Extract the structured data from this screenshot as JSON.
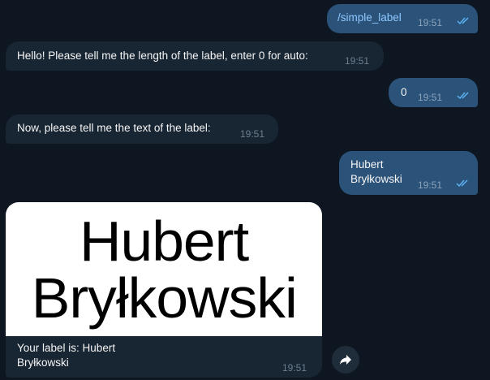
{
  "messages": [
    {
      "text": "/simple_label",
      "time": "19:51"
    },
    {
      "text": "Hello! Please tell me the length of the label, enter 0 for auto:",
      "time": "19:51"
    },
    {
      "text": "0",
      "time": "19:51"
    },
    {
      "text": "Now, please tell me the text of the label:",
      "time": "19:51"
    },
    {
      "line1": "Hubert",
      "line2": "Bryłkowski",
      "time": "19:51"
    }
  ],
  "label_card": {
    "image_line1": "Hubert",
    "image_line2": "Bryłkowski",
    "caption_line1": "Your label is: Hubert",
    "caption_line2": "Bryłkowski",
    "time": "19:51"
  },
  "icons": {
    "read_receipt": "double-check-icon",
    "forward": "forward-arrow-icon"
  },
  "colors": {
    "background": "#0e1621",
    "outgoing": "#2b5278",
    "incoming": "#182533",
    "link": "#8ec8ff",
    "check": "#5eb5f7"
  }
}
